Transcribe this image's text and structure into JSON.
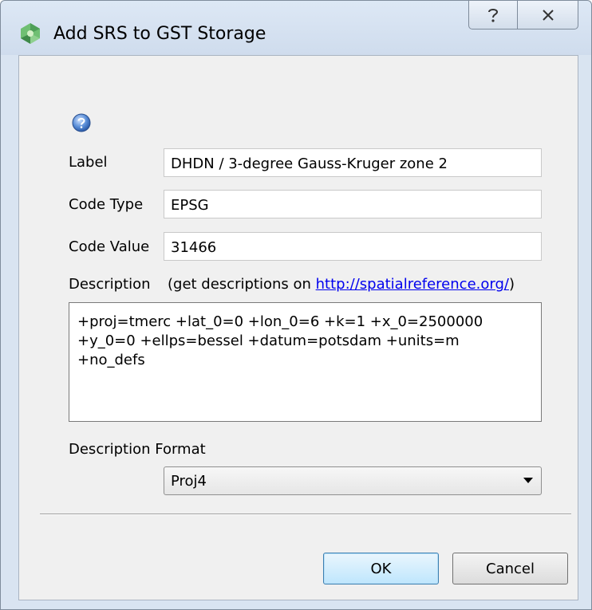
{
  "window": {
    "title": "Add SRS to GST Storage",
    "help_glyph": "?",
    "close_glyph": "✕"
  },
  "form": {
    "label_caption": "Label",
    "label_value": "DHDN / 3-degree Gauss-Kruger zone 2",
    "code_type_caption": "Code Type",
    "code_type_value": "EPSG",
    "code_value_caption": "Code Value",
    "code_value_value": "31466",
    "description_caption": "Description",
    "description_hint_prefix": "(get descriptions on ",
    "description_hint_link": "http://spatialreference.org/",
    "description_hint_suffix": ")",
    "description_value": "+proj=tmerc +lat_0=0 +lon_0=6 +k=1 +x_0=2500000\n+y_0=0 +ellps=bessel +datum=potsdam +units=m\n+no_defs",
    "description_format_caption": "Description Format",
    "description_format_selected": "Proj4"
  },
  "buttons": {
    "ok": "OK",
    "cancel": "Cancel"
  },
  "icons": {
    "app": "qgis-app-icon",
    "help": "help-icon",
    "dropdown": "chevron-down-icon"
  },
  "colors": {
    "link": "#0000ee",
    "default_button": "#bee6fd"
  }
}
